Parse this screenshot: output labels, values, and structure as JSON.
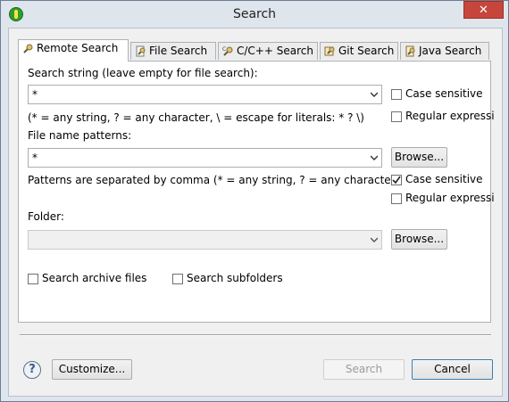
{
  "window": {
    "title": "Search"
  },
  "tabs": [
    {
      "label": "Remote Search",
      "icon": "remote-search-icon"
    },
    {
      "label": "File Search",
      "icon": "file-search-icon"
    },
    {
      "label": "C/C++ Search",
      "icon": "cpp-search-icon"
    },
    {
      "label": "Git Search",
      "icon": "git-search-icon"
    },
    {
      "label": "Java Search",
      "icon": "java-search-icon"
    }
  ],
  "search_string": {
    "label": "Search string (leave empty for file search):",
    "value": "*",
    "hint": "(* = any string, ? = any character, \\ = escape for literals: * ? \\)",
    "case_sensitive": {
      "label": "Case sensitive",
      "checked": false
    },
    "regular_expression": {
      "label": "Regular expressi",
      "checked": false
    }
  },
  "file_name": {
    "label": "File name patterns:",
    "value": "*",
    "browse": "Browse...",
    "hint": "Patterns are separated by comma (* = any string, ? = any character)",
    "case_sensitive": {
      "label": "Case sensitive",
      "checked": true
    },
    "regular_expression": {
      "label": "Regular expressi",
      "checked": false
    }
  },
  "folder": {
    "label": "Folder:",
    "value": "",
    "browse": "Browse..."
  },
  "options": {
    "search_archive": {
      "label": "Search archive files",
      "checked": false
    },
    "search_subfolders": {
      "label": "Search subfolders",
      "checked": false
    }
  },
  "footer": {
    "customize": "Customize...",
    "search": "Search",
    "cancel": "Cancel"
  }
}
